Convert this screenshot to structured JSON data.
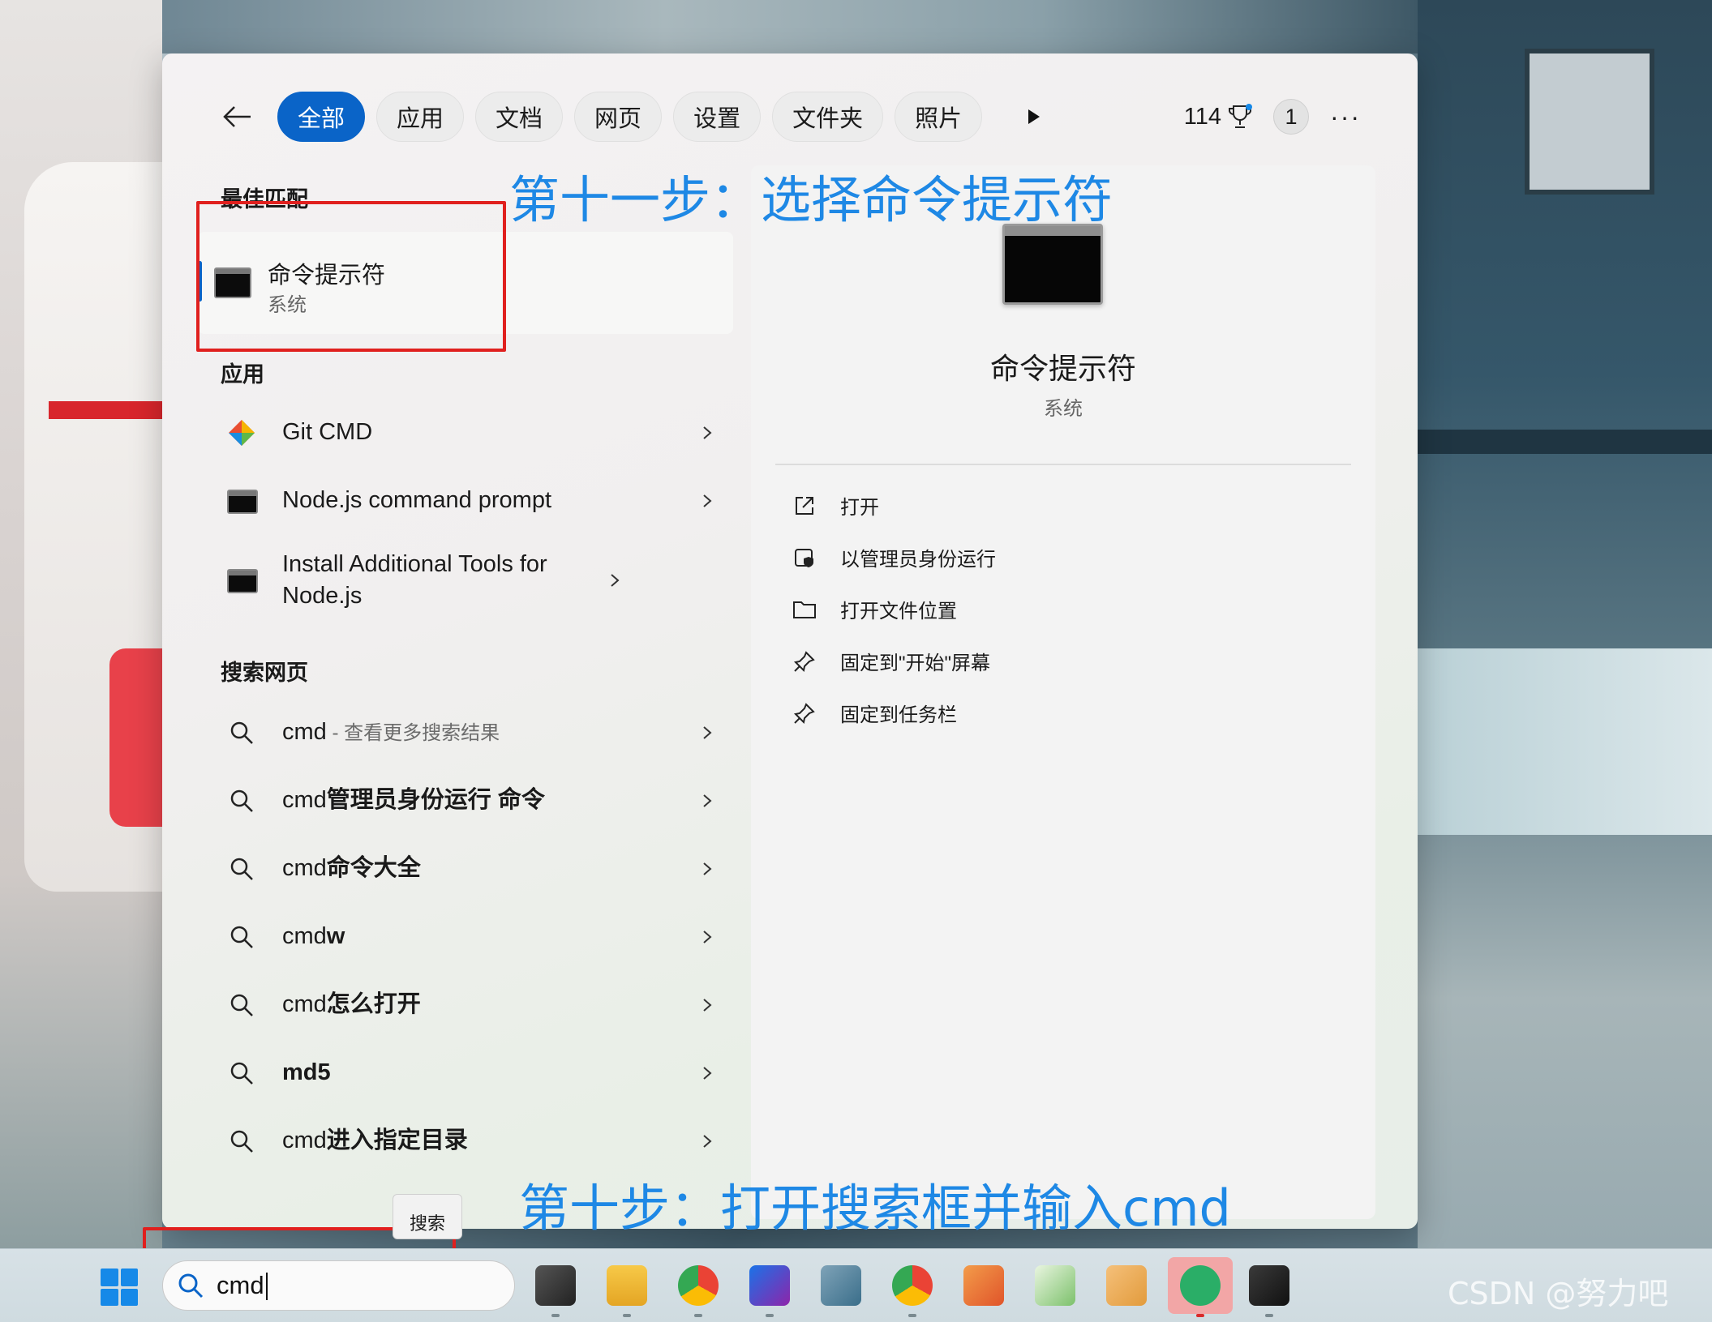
{
  "filters": {
    "tabs": [
      {
        "label": "全部",
        "active": true
      },
      {
        "label": "应用",
        "active": false
      },
      {
        "label": "文档",
        "active": false
      },
      {
        "label": "网页",
        "active": false
      },
      {
        "label": "设置",
        "active": false
      },
      {
        "label": "文件夹",
        "active": false
      },
      {
        "label": "照片",
        "active": false
      }
    ],
    "points": "114",
    "notification_count": "1",
    "more_label": "···"
  },
  "best_match": {
    "section_title": "最佳匹配",
    "title": "命令提示符",
    "subtitle": "系统"
  },
  "apps": {
    "section_title": "应用",
    "items": [
      {
        "label": "Git CMD",
        "icon": "git-icon"
      },
      {
        "label": "Node.js command prompt",
        "icon": "terminal-icon"
      },
      {
        "label": "Install Additional Tools for Node.js",
        "icon": "terminal-icon"
      }
    ]
  },
  "web": {
    "section_title": "搜索网页",
    "first": {
      "query": "cmd",
      "suffix": " - 查看更多搜索结果"
    },
    "items": [
      {
        "prefix": "cmd",
        "bold": "管理员身份运行 命令"
      },
      {
        "prefix": "cmd",
        "bold": "命令大全"
      },
      {
        "prefix": "cmd",
        "bold": "w"
      },
      {
        "prefix": "cmd",
        "bold": "怎么打开"
      },
      {
        "prefix": "",
        "bold": "md5"
      },
      {
        "prefix": "cmd",
        "bold": "进入指定目录"
      }
    ]
  },
  "detail": {
    "title": "命令提示符",
    "subtitle": "系统",
    "actions": [
      {
        "label": "打开",
        "icon": "open-external-icon"
      },
      {
        "label": "以管理员身份运行",
        "icon": "admin-shield-icon"
      },
      {
        "label": "打开文件位置",
        "icon": "folder-icon"
      },
      {
        "label": "固定到\"开始\"屏幕",
        "icon": "pin-icon"
      },
      {
        "label": "固定到任务栏",
        "icon": "pin-icon"
      }
    ]
  },
  "annotations": {
    "step11": "第十一步：选择命令提示符",
    "step10": "第十步：打开搜索框并输入cmd"
  },
  "taskbar": {
    "search_value": "cmd",
    "tooltip": "搜索",
    "watermark": "CSDN @努力吧"
  },
  "colors": {
    "accent": "#0a64c8",
    "annotation": "#1e88e5",
    "highlight_box": "#e0201e"
  }
}
